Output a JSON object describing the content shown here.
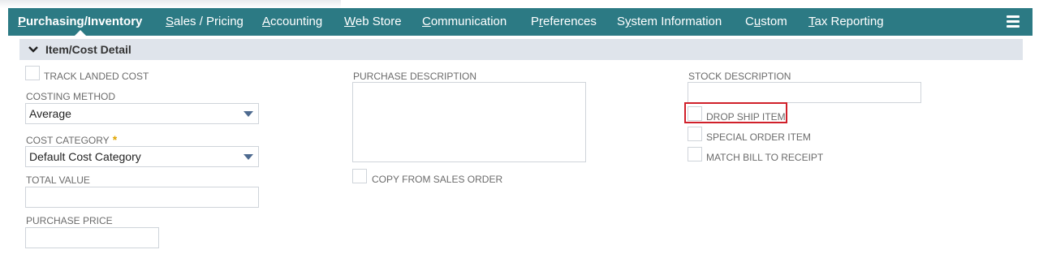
{
  "nav": {
    "tabs": [
      {
        "pre": "",
        "ul": "P",
        "post": "urchasing/Inventory"
      },
      {
        "pre": "",
        "ul": "S",
        "post": "ales / Pricing"
      },
      {
        "pre": "",
        "ul": "A",
        "post": "ccounting"
      },
      {
        "pre": "",
        "ul": "W",
        "post": "eb Store"
      },
      {
        "pre": "",
        "ul": "C",
        "post": "ommunication"
      },
      {
        "pre": "P",
        "ul": "r",
        "post": "eferences"
      },
      {
        "pre": "S",
        "ul": "y",
        "post": "stem Information"
      },
      {
        "pre": "C",
        "ul": "u",
        "post": "stom"
      },
      {
        "pre": "",
        "ul": "T",
        "post": "ax Reporting"
      }
    ],
    "menu_icon": "hamburger-menu-icon"
  },
  "section": {
    "title": "Item/Cost Detail",
    "toggle_icon": "chevron-down-icon"
  },
  "left": {
    "track_landed_cost": "TRACK LANDED COST",
    "costing_method_label": "COSTING METHOD",
    "costing_method_value": "Average",
    "cost_category_label": "COST CATEGORY",
    "required_mark": "*",
    "cost_category_value": "Default Cost Category",
    "total_value_label": "TOTAL VALUE",
    "total_value": "",
    "purchase_price_label": "PURCHASE PRICE",
    "purchase_price": ""
  },
  "middle": {
    "purchase_description_label": "PURCHASE DESCRIPTION",
    "purchase_description": "",
    "copy_from_sales_order": "COPY FROM SALES ORDER"
  },
  "right": {
    "stock_description_label": "STOCK DESCRIPTION",
    "stock_description": "",
    "drop_ship_item": "DROP SHIP ITEM",
    "special_order_item": "SPECIAL ORDER ITEM",
    "match_bill_to_receipt": "MATCH BILL TO RECEIPT"
  },
  "colors": {
    "nav_bg": "#2c7a84",
    "section_bg": "#dfe4eb",
    "highlight": "#d0202a",
    "required": "#e0a500"
  }
}
